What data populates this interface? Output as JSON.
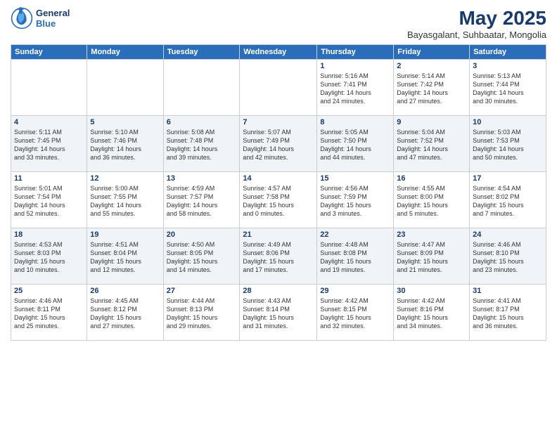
{
  "logo": {
    "line1": "General",
    "line2": "Blue"
  },
  "title": {
    "month_year": "May 2025",
    "location": "Bayasgalant, Suhbaatar, Mongolia"
  },
  "weekdays": [
    "Sunday",
    "Monday",
    "Tuesday",
    "Wednesday",
    "Thursday",
    "Friday",
    "Saturday"
  ],
  "weeks": [
    [
      {
        "day": "",
        "info": ""
      },
      {
        "day": "",
        "info": ""
      },
      {
        "day": "",
        "info": ""
      },
      {
        "day": "",
        "info": ""
      },
      {
        "day": "1",
        "info": "Sunrise: 5:16 AM\nSunset: 7:41 PM\nDaylight: 14 hours\nand 24 minutes."
      },
      {
        "day": "2",
        "info": "Sunrise: 5:14 AM\nSunset: 7:42 PM\nDaylight: 14 hours\nand 27 minutes."
      },
      {
        "day": "3",
        "info": "Sunrise: 5:13 AM\nSunset: 7:44 PM\nDaylight: 14 hours\nand 30 minutes."
      }
    ],
    [
      {
        "day": "4",
        "info": "Sunrise: 5:11 AM\nSunset: 7:45 PM\nDaylight: 14 hours\nand 33 minutes."
      },
      {
        "day": "5",
        "info": "Sunrise: 5:10 AM\nSunset: 7:46 PM\nDaylight: 14 hours\nand 36 minutes."
      },
      {
        "day": "6",
        "info": "Sunrise: 5:08 AM\nSunset: 7:48 PM\nDaylight: 14 hours\nand 39 minutes."
      },
      {
        "day": "7",
        "info": "Sunrise: 5:07 AM\nSunset: 7:49 PM\nDaylight: 14 hours\nand 42 minutes."
      },
      {
        "day": "8",
        "info": "Sunrise: 5:05 AM\nSunset: 7:50 PM\nDaylight: 14 hours\nand 44 minutes."
      },
      {
        "day": "9",
        "info": "Sunrise: 5:04 AM\nSunset: 7:52 PM\nDaylight: 14 hours\nand 47 minutes."
      },
      {
        "day": "10",
        "info": "Sunrise: 5:03 AM\nSunset: 7:53 PM\nDaylight: 14 hours\nand 50 minutes."
      }
    ],
    [
      {
        "day": "11",
        "info": "Sunrise: 5:01 AM\nSunset: 7:54 PM\nDaylight: 14 hours\nand 52 minutes."
      },
      {
        "day": "12",
        "info": "Sunrise: 5:00 AM\nSunset: 7:55 PM\nDaylight: 14 hours\nand 55 minutes."
      },
      {
        "day": "13",
        "info": "Sunrise: 4:59 AM\nSunset: 7:57 PM\nDaylight: 14 hours\nand 58 minutes."
      },
      {
        "day": "14",
        "info": "Sunrise: 4:57 AM\nSunset: 7:58 PM\nDaylight: 15 hours\nand 0 minutes."
      },
      {
        "day": "15",
        "info": "Sunrise: 4:56 AM\nSunset: 7:59 PM\nDaylight: 15 hours\nand 3 minutes."
      },
      {
        "day": "16",
        "info": "Sunrise: 4:55 AM\nSunset: 8:00 PM\nDaylight: 15 hours\nand 5 minutes."
      },
      {
        "day": "17",
        "info": "Sunrise: 4:54 AM\nSunset: 8:02 PM\nDaylight: 15 hours\nand 7 minutes."
      }
    ],
    [
      {
        "day": "18",
        "info": "Sunrise: 4:53 AM\nSunset: 8:03 PM\nDaylight: 15 hours\nand 10 minutes."
      },
      {
        "day": "19",
        "info": "Sunrise: 4:51 AM\nSunset: 8:04 PM\nDaylight: 15 hours\nand 12 minutes."
      },
      {
        "day": "20",
        "info": "Sunrise: 4:50 AM\nSunset: 8:05 PM\nDaylight: 15 hours\nand 14 minutes."
      },
      {
        "day": "21",
        "info": "Sunrise: 4:49 AM\nSunset: 8:06 PM\nDaylight: 15 hours\nand 17 minutes."
      },
      {
        "day": "22",
        "info": "Sunrise: 4:48 AM\nSunset: 8:08 PM\nDaylight: 15 hours\nand 19 minutes."
      },
      {
        "day": "23",
        "info": "Sunrise: 4:47 AM\nSunset: 8:09 PM\nDaylight: 15 hours\nand 21 minutes."
      },
      {
        "day": "24",
        "info": "Sunrise: 4:46 AM\nSunset: 8:10 PM\nDaylight: 15 hours\nand 23 minutes."
      }
    ],
    [
      {
        "day": "25",
        "info": "Sunrise: 4:46 AM\nSunset: 8:11 PM\nDaylight: 15 hours\nand 25 minutes."
      },
      {
        "day": "26",
        "info": "Sunrise: 4:45 AM\nSunset: 8:12 PM\nDaylight: 15 hours\nand 27 minutes."
      },
      {
        "day": "27",
        "info": "Sunrise: 4:44 AM\nSunset: 8:13 PM\nDaylight: 15 hours\nand 29 minutes."
      },
      {
        "day": "28",
        "info": "Sunrise: 4:43 AM\nSunset: 8:14 PM\nDaylight: 15 hours\nand 31 minutes."
      },
      {
        "day": "29",
        "info": "Sunrise: 4:42 AM\nSunset: 8:15 PM\nDaylight: 15 hours\nand 32 minutes."
      },
      {
        "day": "30",
        "info": "Sunrise: 4:42 AM\nSunset: 8:16 PM\nDaylight: 15 hours\nand 34 minutes."
      },
      {
        "day": "31",
        "info": "Sunrise: 4:41 AM\nSunset: 8:17 PM\nDaylight: 15 hours\nand 36 minutes."
      }
    ]
  ]
}
